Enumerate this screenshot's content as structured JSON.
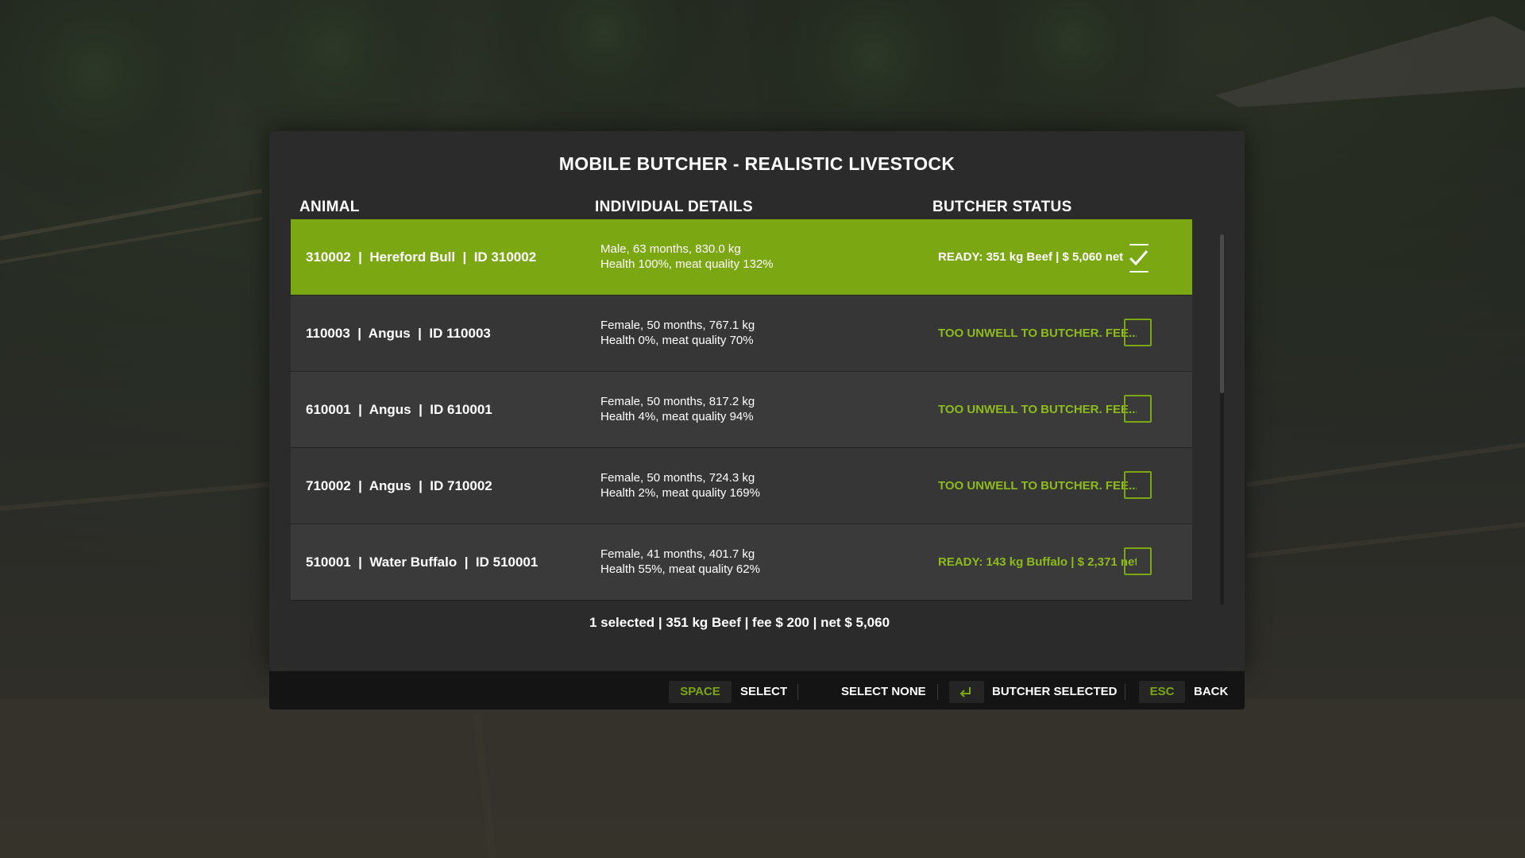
{
  "dialog": {
    "title": "MOBILE BUTCHER - REALISTIC LIVESTOCK",
    "columns": {
      "animal": "ANIMAL",
      "details": "INDIVIDUAL DETAILS",
      "status": "BUTCHER STATUS"
    },
    "rows": [
      {
        "animal": "310002  |  Hereford Bull  |  ID 310002",
        "details_line1": "Male, 63 months, 830.0 kg",
        "details_line2": "Health 100%, meat quality 132%",
        "status": "READY: 351 kg Beef | $ 5,060 net",
        "selected": true
      },
      {
        "animal": "110003  |  Angus  |  ID 110003",
        "details_line1": "Female, 50 months, 767.1 kg",
        "details_line2": "Health 0%, meat quality 70%",
        "status": "TOO UNWELL TO BUTCHER. FEE...",
        "selected": false
      },
      {
        "animal": "610001  |  Angus  |  ID 610001",
        "details_line1": "Female, 50 months, 817.2 kg",
        "details_line2": "Health 4%, meat quality 94%",
        "status": "TOO UNWELL TO BUTCHER. FEE...",
        "selected": false
      },
      {
        "animal": "710002  |  Angus  |  ID 710002",
        "details_line1": "Female, 50 months, 724.3 kg",
        "details_line2": "Health 2%, meat quality 169%",
        "status": "TOO UNWELL TO BUTCHER. FEE...",
        "selected": false
      },
      {
        "animal": "510001  |  Water Buffalo  |  ID 510001",
        "details_line1": "Female, 41 months, 401.7 kg",
        "details_line2": "Health 55%, meat quality 62%",
        "status": "READY: 143 kg Buffalo | $ 2,371 net",
        "selected": false
      }
    ],
    "summary": "1 selected | 351 kg Beef | fee $ 200 | net $ 5,060",
    "scroll_position": 0
  },
  "footer": {
    "space_key": "SPACE",
    "select_label": "SELECT",
    "select_none_label": "SELECT NONE",
    "enter_key_icon": "enter-icon",
    "butcher_selected_label": "BUTCHER SELECTED",
    "esc_key": "ESC",
    "back_label": "BACK"
  },
  "colors": {
    "accent": "#7ba713",
    "status_text": "#8dbb1c",
    "panel": "#2b2b2b",
    "footer": "#141414"
  }
}
